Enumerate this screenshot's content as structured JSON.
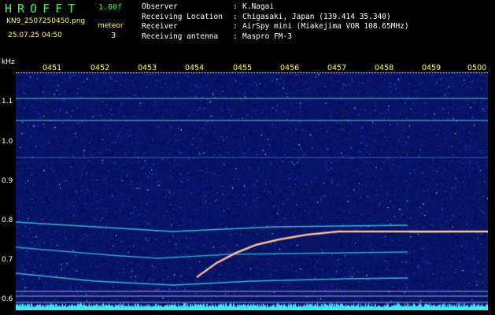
{
  "app": {
    "title": "HROFFT",
    "version": "1.00f",
    "filename": "KN9_2507250450.png",
    "datetime": "25.07.25 04:50",
    "meteor_label": "meteor",
    "meteor_count": "3"
  },
  "meta": [
    {
      "key": "Observer",
      "sep": ":",
      "value": "K.Nagai"
    },
    {
      "key": "Receiving Location",
      "sep": ":",
      "value": "Chigasaki, Japan (139.414 35.340)"
    },
    {
      "key": "Receiver",
      "sep": ":",
      "value": "AirSpy mini (Miakejima VOR 108.65MHz)"
    },
    {
      "key": "Receiving antenna",
      "sep": ":",
      "value": "Maspro FM-3"
    }
  ],
  "axis": {
    "y_unit": "kHz",
    "y_ticks": [
      "1.1",
      "1.0",
      "0.9",
      "0.8",
      "0.7",
      "0.6"
    ],
    "x_ticks": [
      "0451",
      "0452",
      "0453",
      "0454",
      "0455",
      "0456",
      "0457",
      "0458",
      "0459",
      "0500"
    ]
  },
  "colors": {
    "background": "#000000",
    "title": "#3cff3c",
    "info": "#ffff40",
    "noise_base": "#0a1a78",
    "trace": "#40c8e0",
    "meteor_core": "#ffffff",
    "meteor_edge": "#ff5080",
    "noise_floor": "#40e8ff"
  }
}
